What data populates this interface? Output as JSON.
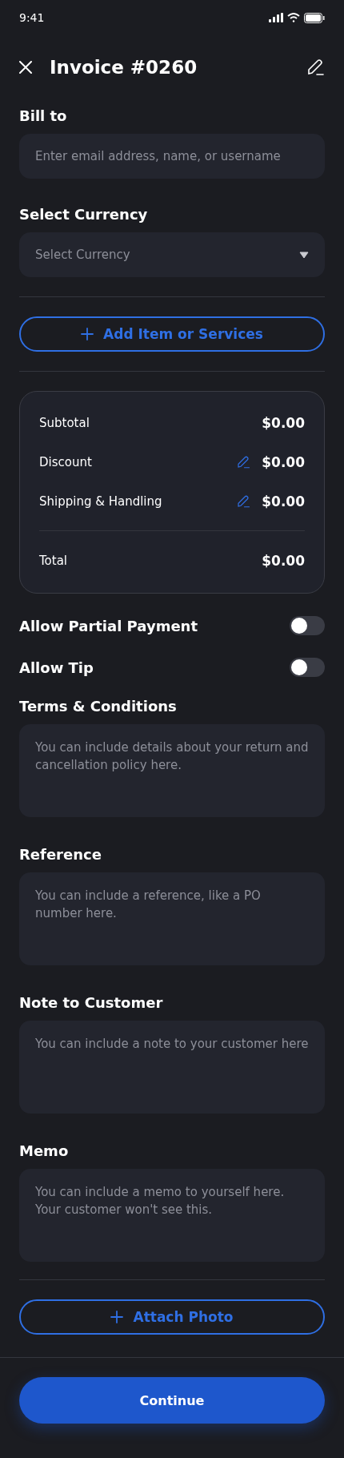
{
  "status_bar": {
    "time": "9:41"
  },
  "header": {
    "title": "Invoice #0260"
  },
  "bill_to": {
    "label": "Bill to",
    "placeholder": "Enter email address, name, or username"
  },
  "currency": {
    "label": "Select Currency",
    "placeholder": "Select Currency"
  },
  "add_item": {
    "label": "Add Item or Services"
  },
  "summary": {
    "rows": [
      {
        "label": "Subtotal",
        "value": "$0.00",
        "editable": false
      },
      {
        "label": "Discount",
        "value": "$0.00",
        "editable": true
      },
      {
        "label": "Shipping & Handling",
        "value": "$0.00",
        "editable": true
      }
    ],
    "total": {
      "label": "Total",
      "value": "$0.00"
    }
  },
  "toggles": [
    {
      "label": "Allow Partial Payment",
      "on": false
    },
    {
      "label": "Allow Tip",
      "on": false
    }
  ],
  "text_areas": [
    {
      "label": "Terms & Conditions",
      "placeholder": "You can include details about your return and cancellation policy here."
    },
    {
      "label": "Reference",
      "placeholder": "You can include a reference, like a PO number here."
    },
    {
      "label": "Note to Customer",
      "placeholder": "You can include a note to your customer here"
    },
    {
      "label": "Memo",
      "placeholder": "You can include a memo to yourself here. Your customer won't see this."
    }
  ],
  "attach": {
    "label": "Attach Photo"
  },
  "continue": {
    "label": "Continue"
  }
}
